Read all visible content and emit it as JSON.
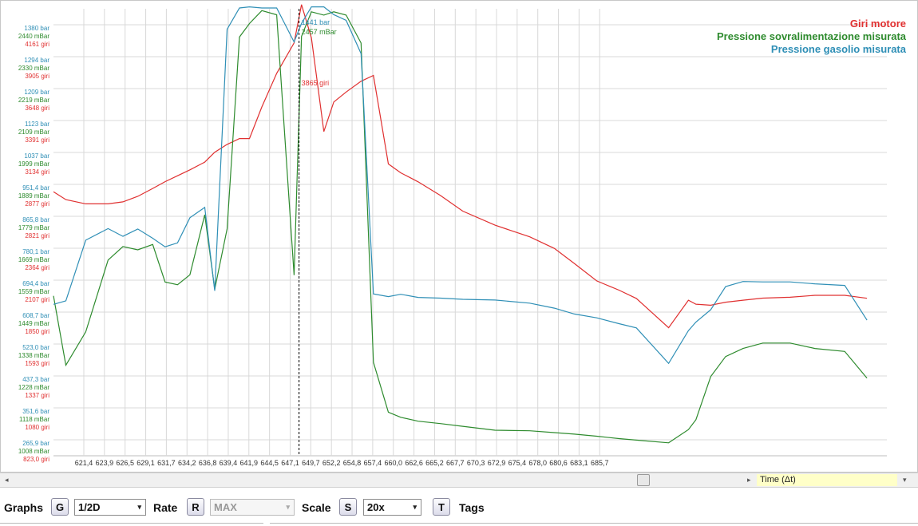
{
  "chart_data": {
    "type": "line",
    "x": [
      619.6,
      620.6,
      622.2,
      624.0,
      625.2,
      626.4,
      627.6,
      628.6,
      629.6,
      630.6,
      631.8,
      632.6,
      633.6,
      634.6,
      635.4,
      636.4,
      637.6,
      639.0,
      639.6,
      640.4,
      641.4,
      642.2,
      643.2,
      644.4,
      645.4,
      646.6,
      647.6,
      649.0,
      650.8,
      652.6,
      655.2,
      658.0,
      660.0,
      661.6,
      663.4,
      665.2,
      666.6,
      669.2,
      670.8,
      671.4,
      672.6,
      673.8,
      675.2,
      676.8,
      679.0,
      681.0,
      683.4,
      685.2
    ],
    "x_ticks": [
      "621,4",
      "623,9",
      "626,5",
      "629,1",
      "631,7",
      "634,2",
      "636,8",
      "639,4",
      "641,9",
      "644,5",
      "647,1",
      "649,7",
      "652,2",
      "654,8",
      "657,4",
      "660,0",
      "662,6",
      "665,2",
      "667,7",
      "670,3",
      "672,9",
      "675,4",
      "678,0",
      "680,6",
      "683,1",
      "685,7"
    ],
    "xlim": [
      619.6,
      686.8
    ],
    "series": [
      {
        "name": "Giri motore",
        "color": "#e03030",
        "axis": "rpm",
        "values": [
          2795,
          2736,
          2704,
          2704,
          2719,
          2760,
          2819,
          2870,
          2914,
          2958,
          3016,
          3090,
          3148,
          3192,
          3192,
          3428,
          3679,
          3906,
          4192,
          3944,
          3244,
          3465,
          3539,
          3620,
          3663,
          3002,
          2936,
          2869,
          2767,
          2650,
          2545,
          2458,
          2371,
          2259,
          2129,
          2060,
          1998,
          1779,
          1985,
          1955,
          1947,
          1970,
          1985,
          2000,
          2007,
          2021,
          2021,
          1999
        ],
        "annotation": {
          "x": 639.4,
          "text": "3865 giri"
        }
      },
      {
        "name": "Pressione sovralimentazione misurata",
        "color": "#2e8b2e",
        "axis": "mbar",
        "values": [
          1485,
          1254,
          1365,
          1604,
          1649,
          1638,
          1656,
          1531,
          1522,
          1555,
          1755,
          1507,
          1708,
          2346,
          2391,
          2434,
          2420,
          1554,
          2348,
          2430,
          2419,
          2430,
          2419,
          2326,
          1264,
          1098,
          1081,
          1068,
          1060,
          1051,
          1038,
          1036,
          1030,
          1025,
          1018,
          1010,
          1005,
          996,
          1040,
          1073,
          1217,
          1283,
          1310,
          1328,
          1328,
          1310,
          1300,
          1211
        ],
        "annotation": {
          "x": 639.4,
          "text": "2457 mBar"
        }
      },
      {
        "name": "Pressione gasolio misurata",
        "color": "#2f8fb6",
        "axis": "bar",
        "values": [
          615,
          624,
          781,
          811,
          791,
          810,
          786,
          764,
          774,
          839,
          866,
          650,
          1327,
          1382,
          1385,
          1382,
          1382,
          1294,
          1342,
          1385,
          1385,
          1365,
          1350,
          1264,
          642,
          635,
          641,
          633,
          631,
          628,
          626,
          618,
          605,
          590,
          580,
          565,
          554,
          462,
          547,
          569,
          601,
          661,
          674,
          673,
          673,
          668,
          664,
          574
        ],
        "annotation": {
          "x": 639.4,
          "text": "1441 bar"
        }
      }
    ],
    "y_ticks": {
      "bar": [
        "1380 bar",
        "1294 bar",
        "1209 bar",
        "1123 bar",
        "1037 bar",
        "951,4 bar",
        "865,8 bar",
        "780,1 bar",
        "694,4 bar",
        "608,7 bar",
        "523,0 bar",
        "437,3 bar",
        "351,6 bar",
        "265,9 bar"
      ],
      "mbar": [
        "2440 mBar",
        "2330 mBar",
        "2219 mBar",
        "2109 mBar",
        "1999 mBar",
        "1889 mBar",
        "1779 mBar",
        "1669 mBar",
        "1559 mBar",
        "1449 mBar",
        "1338 mBar",
        "1228 mBar",
        "1118 mBar",
        "1008 mBar"
      ],
      "rpm": [
        "4161 giri",
        "3905 giri",
        "3648 giri",
        "3391 giri",
        "3134 giri",
        "2877 giri",
        "2821 giri",
        "2364 giri",
        "2107 giri",
        "1850 giri",
        "1593 giri",
        "1337 giri",
        "1080 giri",
        "823,0 giri"
      ]
    },
    "ylim": {
      "bar": [
        223,
        1380
      ],
      "mbar": [
        953,
        2440
      ],
      "rpm": [
        823,
        4161
      ]
    },
    "cursor_x": 639.4,
    "grid": true,
    "legend_position": "top-right"
  },
  "colors": {
    "rpm": "#e03030",
    "mbar": "#2e8b2e",
    "bar": "#2f8fb6",
    "grid": "#d8d8d8",
    "cursor": "#000000"
  },
  "scrollbar": {
    "left_arrow": "◂",
    "right_arrow": "▸",
    "time_label": "Time (Δt)",
    "dropdown_caret": "▾"
  },
  "toolbar": {
    "graphs_label": "Graphs",
    "graphs_key": "G",
    "graphs_value": "1/2D",
    "rate_label": "Rate",
    "rate_key": "R",
    "rate_value": "MAX",
    "scale_label": "Scale",
    "scale_key": "S",
    "scale_value": "20x",
    "tags_key": "T",
    "tags_label": "Tags",
    "caret": "▾"
  }
}
